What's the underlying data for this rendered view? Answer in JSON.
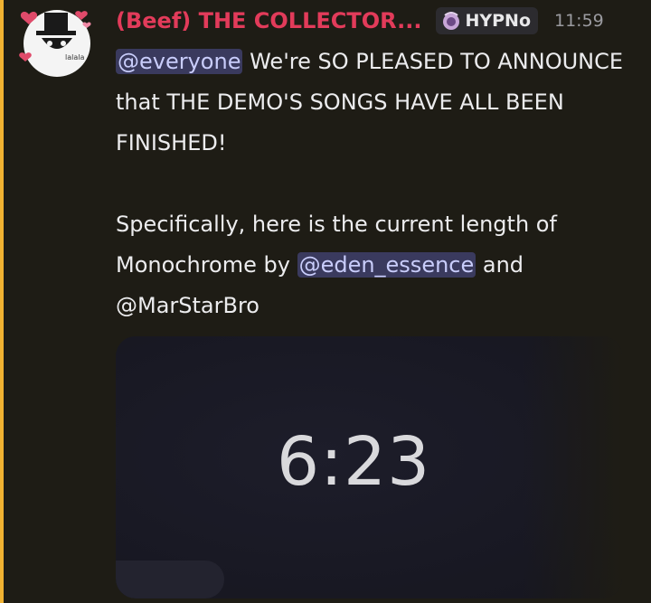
{
  "message": {
    "username": "(Beef) THE COLLECTOR...",
    "tag": "HYPNo",
    "tag_icon": "hypno-crest-icon",
    "timestamp": "11:59",
    "avatar_icon": "top-hat-character-avatar",
    "avatar_text": "lalala",
    "colors": {
      "username": "#e23b5a",
      "mention_bg": "#3a3a5e",
      "mention_text": "#c9cdfb",
      "highlight_bar": "#f0b232",
      "background": "#1e1c15"
    },
    "paragraph1": {
      "mention": "@everyone",
      "text": " We're SO PLEASED TO ANNOUNCE that THE DEMO'S SONGS HAVE ALL BEEN FINISHED!"
    },
    "paragraph2": {
      "before": "Specifically, here is the current length of Monochrome by ",
      "mention": "@eden_essence",
      "after": " and @MarStarBro"
    },
    "attachment": {
      "timer_value": "6:23"
    }
  }
}
